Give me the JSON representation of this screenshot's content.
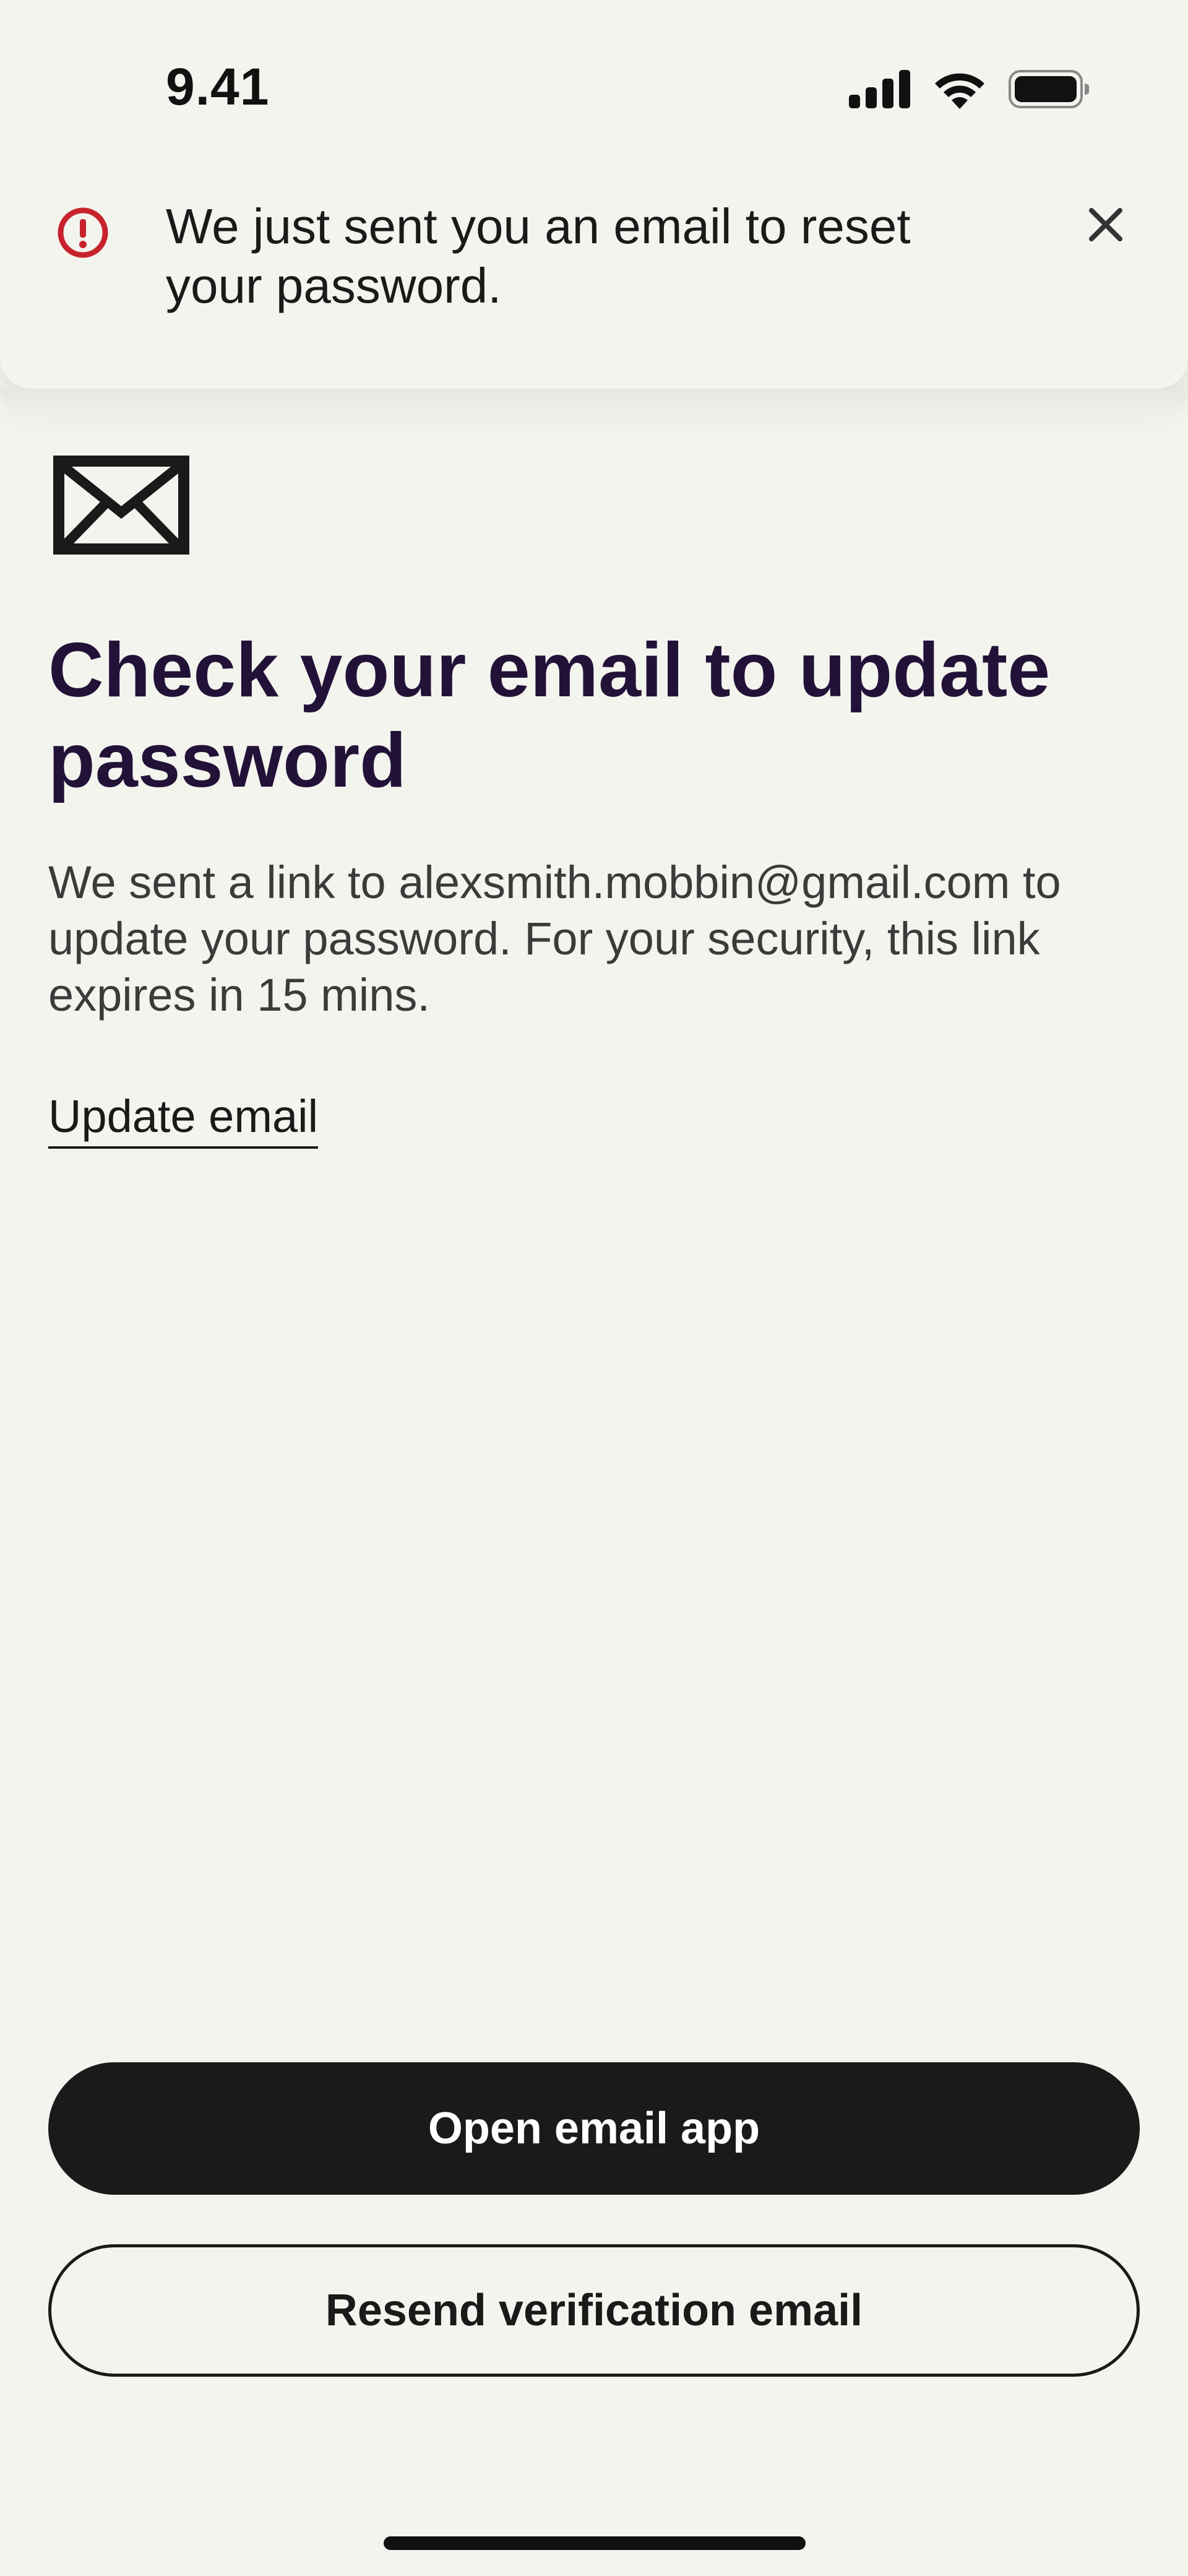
{
  "status_bar": {
    "time": "9.41",
    "icons": [
      "cellular-signal-icon",
      "wifi-icon",
      "battery-icon"
    ]
  },
  "toast": {
    "icon": "alert-circle-icon",
    "message": "We just sent you an email to reset your password.",
    "close_icon": "close-icon",
    "accent_color": "#c8232c"
  },
  "main": {
    "icon": "envelope-icon",
    "title": "Check your email to update password",
    "description": "We sent a link to alexsmith.mobbin@gmail.com to update your password. For your security, this link expires in 15 mins.",
    "update_email_link": "Update email"
  },
  "actions": {
    "primary_label": "Open email app",
    "secondary_label": "Resend verification email"
  },
  "colors": {
    "background": "#f4f4ef",
    "title": "#231238",
    "button_dark": "#1a1a1a"
  }
}
